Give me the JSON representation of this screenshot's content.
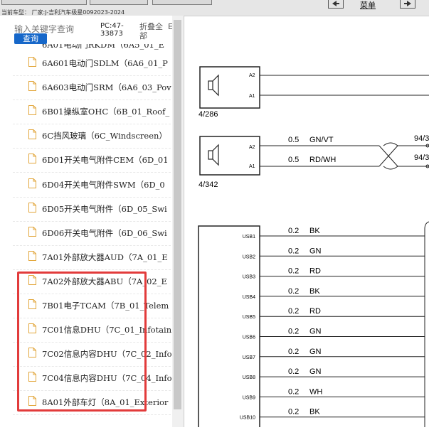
{
  "topbar": {
    "vehicle_label": "当前车型：",
    "manufacturer": "厂家:J-吉利汽车极星0092023-2024",
    "menu_label": "菜单"
  },
  "search": {
    "placeholder": "输入关键字查询",
    "button_label": "查询",
    "pc_code": "PC:47-33873",
    "collapse_label": "折叠全部",
    "truncated_label": "E"
  },
  "tree": {
    "partial_top": "6A01电动门RKDM（6A5_01_E",
    "items": [
      {
        "label": "6A601电动门SDLM（6A6_01_P"
      },
      {
        "label": "6A603电动门SRM（6A6_03_Pov"
      },
      {
        "label": "6B01操纵室OHC（6B_01_Roof_"
      },
      {
        "label": "6C挡风玻璃（6C_Windscreen）"
      },
      {
        "label": "6D01开关电气附件CEM（6D_01"
      },
      {
        "label": "6D04开关电气附件SWM（6D_0"
      },
      {
        "label": "6D05开关电气附件（6D_05_Swi"
      },
      {
        "label": "6D06开关电气附件（6D_06_Swi"
      },
      {
        "label": "7A01外部放大器AUD（7A_01_E"
      },
      {
        "label": "7A02外部放大器ABU（7A_02_E"
      },
      {
        "label": "7B01电子TCAM（7B_01_Telem"
      },
      {
        "label": "7C01信息DHU（7C_01_Infotain"
      },
      {
        "label": "7C02信息内容DHU（7C_02_Info"
      },
      {
        "label": "7C04信息内容DHU（7C_04_Info"
      },
      {
        "label": "8A01外部车灯（8A_01_Exterior"
      }
    ]
  },
  "diagram": {
    "speaker1": {
      "pins": [
        "A2",
        "A1"
      ],
      "ref": "4/286"
    },
    "speaker2": {
      "pins": [
        "A2",
        "A1"
      ],
      "ref": "4/342",
      "wires": [
        {
          "gauge": "0.5",
          "color": "GN/VT",
          "dest": "94/3"
        },
        {
          "gauge": "0.5",
          "color": "RD/WH",
          "dest": "94/3"
        }
      ]
    },
    "usb_block": {
      "pins": [
        "USB1",
        "USB2",
        "USB3",
        "USB4",
        "USB5",
        "USB6",
        "USB7",
        "USB8",
        "USB9",
        "USB10"
      ],
      "wires": [
        {
          "gauge": "0.2",
          "color": "BK"
        },
        {
          "gauge": "0.2",
          "color": "GN"
        },
        {
          "gauge": "0.2",
          "color": "RD"
        },
        {
          "gauge": "0.2",
          "color": "BK"
        },
        {
          "gauge": "0.2",
          "color": "RD"
        },
        {
          "gauge": "0.2",
          "color": "GN"
        },
        {
          "gauge": "0.2",
          "color": "GN"
        },
        {
          "gauge": "0.2",
          "color": "GN"
        },
        {
          "gauge": "0.2",
          "color": "WH"
        },
        {
          "gauge": "0.2",
          "color": "BK"
        }
      ]
    }
  },
  "colors": {
    "accent": "#1667c9",
    "highlight": "#e23b3b"
  }
}
